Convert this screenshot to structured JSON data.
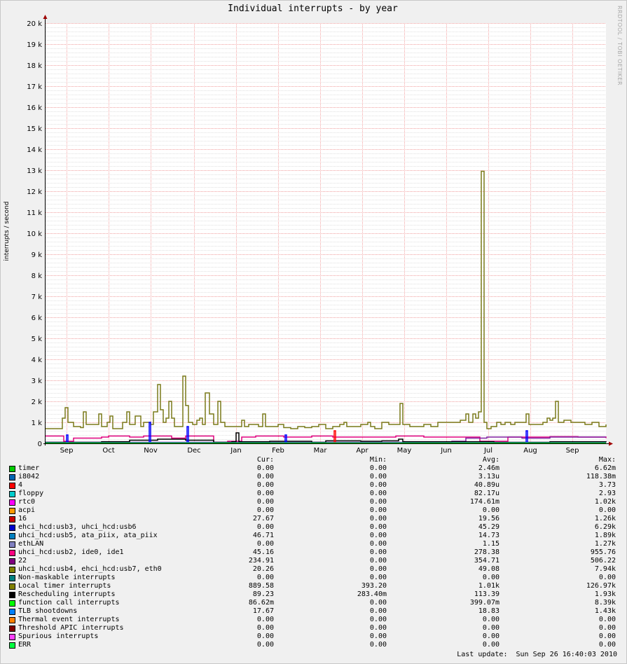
{
  "chart_data": {
    "type": "line",
    "title": "Individual interrupts - by year",
    "ylabel": "interrupts / second",
    "ylim": [
      0,
      20000
    ],
    "yticks": [
      "0",
      "1 k",
      "2 k",
      "3 k",
      "4 k",
      "5 k",
      "6 k",
      "7 k",
      "8 k",
      "9 k",
      "10 k",
      "11 k",
      "12 k",
      "13 k",
      "14 k",
      "15 k",
      "16 k",
      "17 k",
      "18 k",
      "19 k",
      "20 k"
    ],
    "xlim": [
      0,
      400
    ],
    "x_months": [
      {
        "label": "Sep",
        "x": 15
      },
      {
        "label": "Oct",
        "x": 45
      },
      {
        "label": "Nov",
        "x": 75
      },
      {
        "label": "Dec",
        "x": 106
      },
      {
        "label": "Jan",
        "x": 136
      },
      {
        "label": "Feb",
        "x": 166
      },
      {
        "label": "Mar",
        "x": 196
      },
      {
        "label": "Apr",
        "x": 226
      },
      {
        "label": "May",
        "x": 256
      },
      {
        "label": "Jun",
        "x": 286
      },
      {
        "label": "Jul",
        "x": 316
      },
      {
        "label": "Aug",
        "x": 346
      },
      {
        "label": "Sep",
        "x": 376
      }
    ],
    "grid": true,
    "series": [
      {
        "name": "Local timer interrupts",
        "color": "#7a7a1a",
        "type": "step",
        "points": [
          [
            0,
            700
          ],
          [
            10,
            700
          ],
          [
            12,
            1200
          ],
          [
            14,
            1700
          ],
          [
            16,
            1000
          ],
          [
            20,
            800
          ],
          [
            25,
            750
          ],
          [
            27,
            1500
          ],
          [
            29,
            900
          ],
          [
            35,
            900
          ],
          [
            38,
            1400
          ],
          [
            40,
            800
          ],
          [
            44,
            1000
          ],
          [
            46,
            1300
          ],
          [
            48,
            700
          ],
          [
            55,
            1000
          ],
          [
            58,
            1500
          ],
          [
            60,
            900
          ],
          [
            64,
            1300
          ],
          [
            66,
            1300
          ],
          [
            68,
            800
          ],
          [
            70,
            1000
          ],
          [
            73,
            1000
          ],
          [
            75,
            900
          ],
          [
            77,
            1500
          ],
          [
            80,
            2800
          ],
          [
            82,
            1600
          ],
          [
            84,
            1000
          ],
          [
            86,
            1200
          ],
          [
            88,
            2000
          ],
          [
            90,
            1200
          ],
          [
            92,
            800
          ],
          [
            98,
            3200
          ],
          [
            100,
            1800
          ],
          [
            102,
            1000
          ],
          [
            105,
            900
          ],
          [
            108,
            1100
          ],
          [
            110,
            1200
          ],
          [
            112,
            900
          ],
          [
            114,
            2400
          ],
          [
            117,
            1400
          ],
          [
            120,
            900
          ],
          [
            123,
            2000
          ],
          [
            125,
            1000
          ],
          [
            128,
            800
          ],
          [
            135,
            800
          ],
          [
            140,
            1100
          ],
          [
            142,
            800
          ],
          [
            145,
            900
          ],
          [
            148,
            900
          ],
          [
            152,
            800
          ],
          [
            155,
            1400
          ],
          [
            157,
            800
          ],
          [
            162,
            800
          ],
          [
            166,
            900
          ],
          [
            170,
            750
          ],
          [
            175,
            700
          ],
          [
            180,
            800
          ],
          [
            185,
            750
          ],
          [
            190,
            800
          ],
          [
            195,
            900
          ],
          [
            200,
            700
          ],
          [
            205,
            800
          ],
          [
            210,
            900
          ],
          [
            213,
            1000
          ],
          [
            215,
            800
          ],
          [
            220,
            800
          ],
          [
            225,
            900
          ],
          [
            230,
            1000
          ],
          [
            232,
            800
          ],
          [
            235,
            700
          ],
          [
            240,
            1000
          ],
          [
            245,
            900
          ],
          [
            250,
            900
          ],
          [
            253,
            1900
          ],
          [
            255,
            900
          ],
          [
            260,
            800
          ],
          [
            265,
            800
          ],
          [
            270,
            900
          ],
          [
            275,
            800
          ],
          [
            280,
            1000
          ],
          [
            285,
            1000
          ],
          [
            290,
            1000
          ],
          [
            293,
            1000
          ],
          [
            296,
            1100
          ],
          [
            300,
            1400
          ],
          [
            302,
            1000
          ],
          [
            305,
            1400
          ],
          [
            307,
            1200
          ],
          [
            309,
            1500
          ],
          [
            311,
            12950
          ],
          [
            313,
            1000
          ],
          [
            315,
            700
          ],
          [
            318,
            800
          ],
          [
            322,
            1000
          ],
          [
            325,
            900
          ],
          [
            328,
            1000
          ],
          [
            332,
            900
          ],
          [
            335,
            1000
          ],
          [
            340,
            1000
          ],
          [
            343,
            1400
          ],
          [
            345,
            900
          ],
          [
            350,
            900
          ],
          [
            355,
            1000
          ],
          [
            358,
            1200
          ],
          [
            360,
            1100
          ],
          [
            362,
            1200
          ],
          [
            364,
            2000
          ],
          [
            366,
            1000
          ],
          [
            370,
            1100
          ],
          [
            375,
            1000
          ],
          [
            380,
            1000
          ],
          [
            385,
            900
          ],
          [
            390,
            1000
          ],
          [
            395,
            800
          ],
          [
            400,
            900
          ]
        ]
      },
      {
        "name": "uhci_hcd:usb2, ide0, ide1",
        "color": "#e0007f",
        "type": "step",
        "points": [
          [
            0,
            350
          ],
          [
            10,
            350
          ],
          [
            13,
            100
          ],
          [
            20,
            250
          ],
          [
            40,
            300
          ],
          [
            45,
            350
          ],
          [
            60,
            300
          ],
          [
            70,
            350
          ],
          [
            80,
            350
          ],
          [
            90,
            250
          ],
          [
            100,
            350
          ],
          [
            120,
            50
          ],
          [
            130,
            100
          ],
          [
            140,
            300
          ],
          [
            150,
            350
          ],
          [
            170,
            300
          ],
          [
            190,
            350
          ],
          [
            205,
            300
          ],
          [
            215,
            300
          ],
          [
            230,
            300
          ],
          [
            250,
            350
          ],
          [
            270,
            300
          ],
          [
            290,
            300
          ],
          [
            310,
            100
          ],
          [
            330,
            300
          ],
          [
            360,
            320
          ],
          [
            380,
            300
          ],
          [
            400,
            250
          ]
        ]
      },
      {
        "name": "22",
        "color": "#7f1f9f",
        "type": "step",
        "points": [
          [
            0,
            50
          ],
          [
            150,
            50
          ],
          [
            200,
            50
          ],
          [
            250,
            50
          ],
          [
            290,
            100
          ],
          [
            300,
            250
          ],
          [
            315,
            300
          ],
          [
            340,
            250
          ],
          [
            360,
            300
          ],
          [
            380,
            300
          ],
          [
            400,
            300
          ]
        ]
      },
      {
        "name": "Rescheduling interrupts",
        "color": "#000000",
        "type": "step",
        "points": [
          [
            0,
            50
          ],
          [
            40,
            80
          ],
          [
            60,
            150
          ],
          [
            80,
            200
          ],
          [
            100,
            150
          ],
          [
            120,
            50
          ],
          [
            133,
            80
          ],
          [
            136,
            500
          ],
          [
            138,
            80
          ],
          [
            160,
            100
          ],
          [
            190,
            50
          ],
          [
            200,
            120
          ],
          [
            225,
            100
          ],
          [
            240,
            120
          ],
          [
            252,
            200
          ],
          [
            255,
            80
          ],
          [
            280,
            80
          ],
          [
            320,
            50
          ],
          [
            360,
            80
          ],
          [
            400,
            50
          ]
        ]
      },
      {
        "name": "ehci_hcd:usb3, uhci_hcd:usb6",
        "color": "#0000ff",
        "type": "step",
        "points": [
          [
            0,
            0
          ],
          [
            14,
            0
          ],
          [
            15,
            400
          ],
          [
            16,
            0
          ],
          [
            73,
            0
          ],
          [
            74,
            1000
          ],
          [
            75,
            0
          ],
          [
            100,
            0
          ],
          [
            101,
            800
          ],
          [
            102,
            0
          ],
          [
            170,
            0
          ],
          [
            171,
            400
          ],
          [
            172,
            0
          ],
          [
            342,
            0
          ],
          [
            343,
            600
          ],
          [
            344,
            0
          ],
          [
            400,
            0
          ]
        ]
      },
      {
        "name": "16",
        "color": "#ff0000",
        "type": "step",
        "points": [
          [
            0,
            0
          ],
          [
            205,
            0
          ],
          [
            206,
            600
          ],
          [
            207,
            0
          ],
          [
            400,
            0
          ]
        ]
      },
      {
        "name": "uhci_hcd:usb5, ata_piix, ata_piix",
        "color": "#1f7fbf",
        "type": "step",
        "points": [
          [
            0,
            30
          ],
          [
            100,
            30
          ],
          [
            200,
            30
          ],
          [
            300,
            30
          ],
          [
            400,
            30
          ]
        ]
      },
      {
        "name": "function call interrupts",
        "color": "#00cf00",
        "type": "step",
        "points": [
          [
            0,
            10
          ],
          [
            400,
            10
          ]
        ]
      }
    ]
  },
  "legend": {
    "headers": {
      "cur": "Cur:",
      "min": "Min:",
      "avg": "Avg:",
      "max": "Max:"
    },
    "rows": [
      {
        "color": "#00cc00",
        "name": "timer",
        "cur": "0.00",
        "min": "0.00",
        "avg": "2.46m",
        "max": "6.62m"
      },
      {
        "color": "#0066b3",
        "name": "i8042",
        "cur": "0.00",
        "min": "0.00",
        "avg": "3.13u",
        "max": "118.38m"
      },
      {
        "color": "#ff0000",
        "name": "4",
        "cur": "0.00",
        "min": "0.00",
        "avg": "40.89u",
        "max": "3.73"
      },
      {
        "color": "#00cccc",
        "name": "floppy",
        "cur": "0.00",
        "min": "0.00",
        "avg": "82.17u",
        "max": "2.93"
      },
      {
        "color": "#ff00ff",
        "name": "rtc0",
        "cur": "0.00",
        "min": "0.00",
        "avg": "174.61m",
        "max": "1.02k"
      },
      {
        "color": "#ff9900",
        "name": "acpi",
        "cur": "0.00",
        "min": "0.00",
        "avg": "0.00",
        "max": "0.00"
      },
      {
        "color": "#cc0000",
        "name": "16",
        "cur": "27.67",
        "min": "0.00",
        "avg": "19.56",
        "max": "1.26k"
      },
      {
        "color": "#0000cc",
        "name": "ehci_hcd:usb3, uhci_hcd:usb6",
        "cur": "0.00",
        "min": "0.00",
        "avg": "45.29",
        "max": "6.29k"
      },
      {
        "color": "#0080c0",
        "name": "uhci_hcd:usb5, ata_piix, ata_piix",
        "cur": "46.71",
        "min": "0.00",
        "avg": "14.73",
        "max": "1.89k"
      },
      {
        "color": "#8080c0",
        "name": "ethLAN",
        "cur": "0.00",
        "min": "0.00",
        "avg": "1.15",
        "max": "1.27k"
      },
      {
        "color": "#ff0080",
        "name": "uhci_hcd:usb2, ide0, ide1",
        "cur": "45.16",
        "min": "0.00",
        "avg": "278.38",
        "max": "955.76"
      },
      {
        "color": "#800080",
        "name": "22",
        "cur": "234.91",
        "min": "0.00",
        "avg": "354.71",
        "max": "506.22"
      },
      {
        "color": "#808000",
        "name": "uhci_hcd:usb4, ehci_hcd:usb7, eth0",
        "cur": "20.26",
        "min": "0.00",
        "avg": "49.08",
        "max": "7.94k"
      },
      {
        "color": "#008080",
        "name": "Non-maskable interrupts",
        "cur": "0.00",
        "min": "0.00",
        "avg": "0.00",
        "max": "0.00"
      },
      {
        "color": "#808000",
        "name": "Local timer interrupts",
        "cur": "889.58",
        "min": "393.20",
        "avg": "1.01k",
        "max": "126.97k"
      },
      {
        "color": "#000000",
        "name": "Rescheduling interrupts",
        "cur": "89.23",
        "min": "283.40m",
        "avg": "113.39",
        "max": "1.93k"
      },
      {
        "color": "#00ff00",
        "name": "function call interrupts",
        "cur": "86.62m",
        "min": "0.00",
        "avg": "399.07m",
        "max": "8.39k"
      },
      {
        "color": "#0080ff",
        "name": "TLB shootdowns",
        "cur": "17.67",
        "min": "0.00",
        "avg": "18.83",
        "max": "1.43k"
      },
      {
        "color": "#ff8000",
        "name": "Thermal event interrupts",
        "cur": "0.00",
        "min": "0.00",
        "avg": "0.00",
        "max": "0.00"
      },
      {
        "color": "#800000",
        "name": "Threshold APIC interrupts",
        "cur": "0.00",
        "min": "0.00",
        "avg": "0.00",
        "max": "0.00"
      },
      {
        "color": "#ff40ff",
        "name": "Spurious interrupts",
        "cur": "0.00",
        "min": "0.00",
        "avg": "0.00",
        "max": "0.00"
      },
      {
        "color": "#00ff40",
        "name": "ERR",
        "cur": "0.00",
        "min": "0.00",
        "avg": "0.00",
        "max": "0.00"
      }
    ]
  },
  "watermark": "RRDTOOL / TOBI OETIKER",
  "last_update": "Last update:  Sun Sep 26 16:40:03 2010"
}
